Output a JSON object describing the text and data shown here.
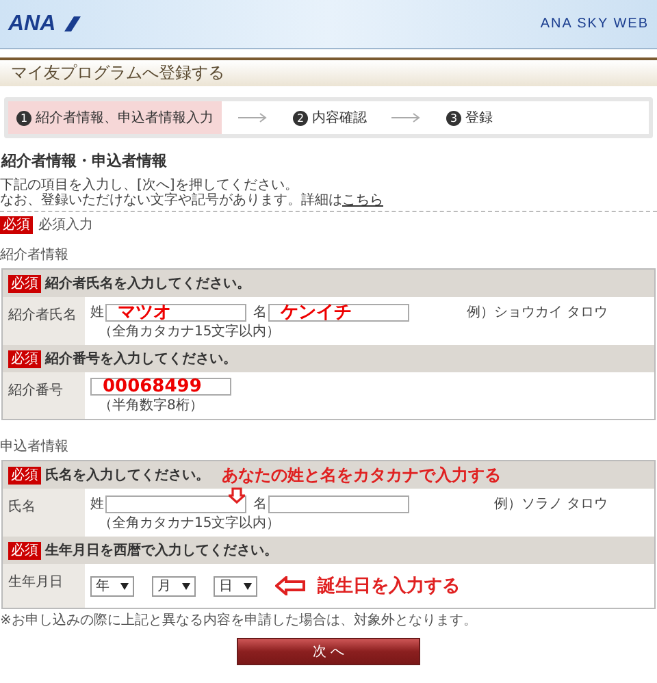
{
  "header": {
    "logo": "ANA",
    "site": "ANA SKY WEB"
  },
  "page_title": "マイ友プログラムへ登録する",
  "steps": [
    {
      "number": "1",
      "label": "紹介者情報、申込者情報入力",
      "selected": true
    },
    {
      "number": "2",
      "label": "内容確認",
      "selected": false
    },
    {
      "number": "3",
      "label": "登録",
      "selected": false
    }
  ],
  "heading": "紹介者情報・申込者情報",
  "intro": {
    "line_1": "下記の項目を入力し、[次へ]を押してください。",
    "line_2": "なお、登録いただけない文字や記号があります。詳細は",
    "link": "こちら"
  },
  "required_legend": {
    "badge": "必須",
    "text": "必須入力"
  },
  "sections": [
    {
      "label": "紹介者情報",
      "groups": [
        {
          "kind": "name",
          "badge": "必須",
          "prompt": "紹介者氏名を入力してください。",
          "field_label": "紹介者氏名",
          "sei_label": "姓",
          "sei_value": "マツオ",
          "mei_label": "名",
          "mei_value": "ケンイチ",
          "hint": "（全角カタカナ15文字以内）",
          "example": "例）ショウカイ タロウ"
        },
        {
          "kind": "number",
          "badge": "必須",
          "prompt": "紹介番号を入力してください。",
          "field_label": "紹介番号",
          "value": "00068499",
          "hint": "（半角数字8桁）"
        }
      ]
    },
    {
      "label": "申込者情報",
      "groups": [
        {
          "kind": "name",
          "badge": "必須",
          "prompt": "氏名を入力してください。",
          "field_label": "氏名",
          "sei_label": "姓",
          "mei_label": "名",
          "hint": "（全角カタカナ15文字以内）",
          "example": "例）ソラノ タロウ",
          "annotation": "あなたの姓と名をカタカナで入力する"
        },
        {
          "kind": "date",
          "badge": "必須",
          "prompt": "生年月日を西暦で入力してください。",
          "field_label": "生年月日",
          "selects": [
            "年",
            "月",
            "日"
          ],
          "annotation": "誕生日を入力する"
        }
      ]
    }
  ],
  "note": "※お申し込みの際に上記と異なる内容を申請した場合は、対象外となります。",
  "next_button": "次 へ"
}
